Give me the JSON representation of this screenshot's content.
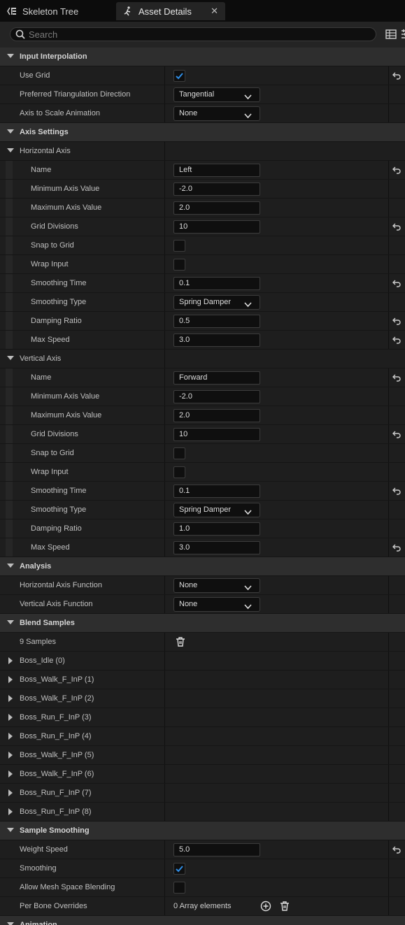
{
  "tabs": [
    {
      "label": "Skeleton Tree",
      "icon": "skeleton-tree-icon"
    },
    {
      "label": "Asset Details",
      "icon": "asset-details-icon",
      "close": "✕"
    }
  ],
  "search": {
    "placeholder": "Search"
  },
  "sections": {
    "input_interpolation": "Input Interpolation",
    "axis_settings": "Axis Settings",
    "analysis": "Analysis",
    "blend_samples": "Blend Samples",
    "sample_smoothing": "Sample Smoothing",
    "animation": "Animation"
  },
  "input_interpolation": {
    "use_grid_label": "Use Grid",
    "use_grid": true,
    "triangulation_label": "Preferred Triangulation Direction",
    "triangulation_value": "Tangential",
    "axis_scale_label": "Axis to Scale Animation",
    "axis_scale_value": "None"
  },
  "horizontal_axis": {
    "title": "Horizontal Axis",
    "name_label": "Name",
    "name": "Left",
    "min_label": "Minimum Axis Value",
    "min": "-2.0",
    "max_label": "Maximum Axis Value",
    "max": "2.0",
    "grid_label": "Grid Divisions",
    "grid": "10",
    "snap_label": "Snap to Grid",
    "snap": false,
    "wrap_label": "Wrap Input",
    "wrap": false,
    "smooth_time_label": "Smoothing Time",
    "smooth_time": "0.1",
    "smooth_type_label": "Smoothing Type",
    "smooth_type": "Spring Damper",
    "damping_label": "Damping Ratio",
    "damping": "0.5",
    "max_speed_label": "Max Speed",
    "max_speed": "3.0"
  },
  "vertical_axis": {
    "title": "Vertical Axis",
    "name_label": "Name",
    "name": "Forward",
    "min_label": "Minimum Axis Value",
    "min": "-2.0",
    "max_label": "Maximum Axis Value",
    "max": "2.0",
    "grid_label": "Grid Divisions",
    "grid": "10",
    "snap_label": "Snap to Grid",
    "snap": false,
    "wrap_label": "Wrap Input",
    "wrap": false,
    "smooth_time_label": "Smoothing Time",
    "smooth_time": "0.1",
    "smooth_type_label": "Smoothing Type",
    "smooth_type": "Spring Damper",
    "damping_label": "Damping Ratio",
    "damping": "1.0",
    "max_speed_label": "Max Speed",
    "max_speed": "3.0"
  },
  "analysis": {
    "h_label": "Horizontal Axis Function",
    "h_value": "None",
    "v_label": "Vertical Axis Function",
    "v_value": "None"
  },
  "blend_samples": {
    "count_label": "9 Samples",
    "items": [
      "Boss_Idle (0)",
      "Boss_Walk_F_InP (1)",
      "Boss_Walk_F_InP (2)",
      "Boss_Run_F_InP (3)",
      "Boss_Run_F_InP (4)",
      "Boss_Walk_F_InP (5)",
      "Boss_Walk_F_InP (6)",
      "Boss_Run_F_InP (7)",
      "Boss_Run_F_InP (8)"
    ]
  },
  "sample_smoothing": {
    "weight_speed_label": "Weight Speed",
    "weight_speed": "5.0",
    "smoothing_label": "Smoothing",
    "smoothing": true,
    "mesh_blend_label": "Allow Mesh Space Blending",
    "mesh_blend": false,
    "per_bone_label": "Per Bone Overrides",
    "per_bone_value": "0 Array elements"
  },
  "colors": {
    "background": "#151515",
    "section_header": "#2e2e2e",
    "row": "#1e1e1e",
    "checkbox_check": "#2f8fe8"
  }
}
